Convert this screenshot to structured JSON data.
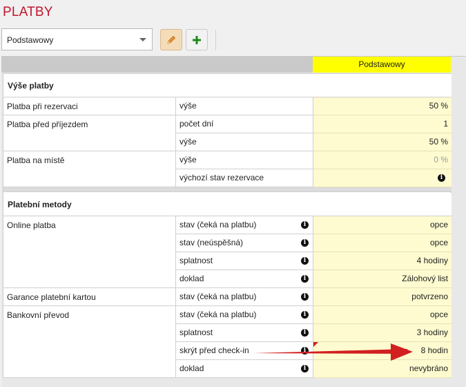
{
  "page": {
    "title": "PLATBY"
  },
  "toolbar": {
    "plan_select_value": "Podstawowy",
    "edit_icon": "pencil-icon",
    "add_icon": "plus-icon"
  },
  "grid": {
    "column_header": "Podstawowy",
    "sections": {
      "amounts": "Výše platby",
      "methods": "Platební metody"
    },
    "rows": {
      "reservation": {
        "label": "Platba při rezervaci",
        "field": "výše",
        "value": "50 %"
      },
      "before_arrival": {
        "label": "Platba před příjezdem",
        "days_field": "počet dní",
        "days_value": "1",
        "amount_field": "výše",
        "amount_value": "50 %"
      },
      "on_site": {
        "label": "Platba na místě",
        "amount_field": "výše",
        "amount_value": "0 %",
        "default_state_field": "výchozí stav rezervace"
      },
      "online": {
        "label": "Online platba",
        "waiting_field": "stav (čeká na platbu)",
        "waiting_value": "opce",
        "failed_field": "stav (neúspěšná)",
        "failed_value": "opce",
        "due_field": "splatnost",
        "due_value": "4 hodiny",
        "document_field": "doklad",
        "document_value": "Zálohový list"
      },
      "card_guarantee": {
        "label": "Garance platební kartou",
        "waiting_field": "stav (čeká na platbu)",
        "waiting_value": "potvrzeno"
      },
      "bank_transfer": {
        "label": "Bankovní převod",
        "waiting_field": "stav (čeká na platbu)",
        "waiting_value": "opce",
        "due_field": "splatnost",
        "due_value": "3 hodiny",
        "hide_field": "skrýt před check-in",
        "hide_value": "8 hodin",
        "document_field": "doklad",
        "document_value": "nevybráno"
      }
    }
  },
  "colors": {
    "title": "#c0152f",
    "header_highlight": "#ffff00",
    "value_cell": "#fdfbcf",
    "annotation_arrow": "#d21f1f",
    "add_icon": "#1b8a1b",
    "edit_icon": "#e07b1a"
  }
}
